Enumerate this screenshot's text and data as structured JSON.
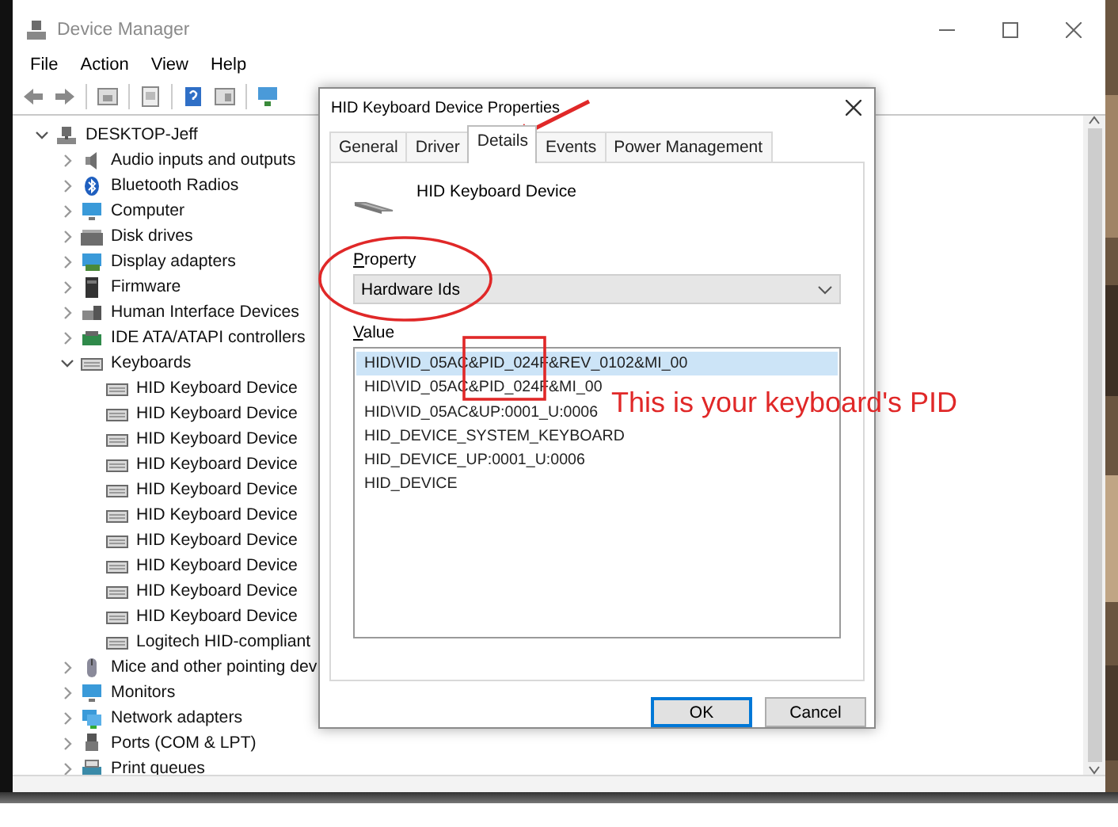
{
  "window": {
    "title": "Device Manager",
    "menu": [
      "File",
      "Action",
      "View",
      "Help"
    ]
  },
  "tree": {
    "label": "DESKTOP-Jeff",
    "kind": "computer",
    "expanded": true,
    "children": [
      {
        "label": "Audio inputs and outputs",
        "kind": "speaker",
        "expanded": false
      },
      {
        "label": "Bluetooth Radios",
        "kind": "bluetooth",
        "expanded": false
      },
      {
        "label": "Computer",
        "kind": "monitor",
        "expanded": false
      },
      {
        "label": "Disk drives",
        "kind": "drive",
        "expanded": false
      },
      {
        "label": "Display adapters",
        "kind": "display",
        "expanded": false
      },
      {
        "label": "Firmware",
        "kind": "chip",
        "expanded": false
      },
      {
        "label": "Human Interface Devices",
        "kind": "hid",
        "expanded": false
      },
      {
        "label": "IDE ATA/ATAPI controllers",
        "kind": "controller",
        "expanded": false
      },
      {
        "label": "Keyboards",
        "kind": "keyboard",
        "expanded": true,
        "children": [
          {
            "label": "HID Keyboard Device",
            "kind": "keyboard"
          },
          {
            "label": "HID Keyboard Device",
            "kind": "keyboard"
          },
          {
            "label": "HID Keyboard Device",
            "kind": "keyboard"
          },
          {
            "label": "HID Keyboard Device",
            "kind": "keyboard"
          },
          {
            "label": "HID Keyboard Device",
            "kind": "keyboard"
          },
          {
            "label": "HID Keyboard Device",
            "kind": "keyboard"
          },
          {
            "label": "HID Keyboard Device",
            "kind": "keyboard"
          },
          {
            "label": "HID Keyboard Device",
            "kind": "keyboard"
          },
          {
            "label": "HID Keyboard Device",
            "kind": "keyboard"
          },
          {
            "label": "HID Keyboard Device",
            "kind": "keyboard"
          },
          {
            "label": "Logitech HID-compliant",
            "kind": "keyboard"
          }
        ]
      },
      {
        "label": "Mice and other pointing dev",
        "kind": "mouse",
        "expanded": false
      },
      {
        "label": "Monitors",
        "kind": "monitor",
        "expanded": false
      },
      {
        "label": "Network adapters",
        "kind": "network",
        "expanded": false
      },
      {
        "label": "Ports (COM & LPT)",
        "kind": "port",
        "expanded": false
      },
      {
        "label": "Print queues",
        "kind": "printer",
        "expanded": false
      }
    ]
  },
  "dialog": {
    "title": "HID Keyboard Device Properties",
    "tabs": [
      {
        "label": "General",
        "selected": false
      },
      {
        "label": "Driver",
        "selected": false
      },
      {
        "label": "Details",
        "selected": true
      },
      {
        "label": "Events",
        "selected": false
      },
      {
        "label": "Power Management",
        "selected": false
      }
    ],
    "device_name": "HID Keyboard Device",
    "property_label": "Property",
    "property_value": "Hardware Ids",
    "value_label": "Value",
    "values": [
      {
        "text": "HID\\VID_05AC&PID_024F&REV_0102&MI_00",
        "selected": true
      },
      {
        "text": "HID\\VID_05AC&PID_024F&MI_00",
        "selected": false
      },
      {
        "text": "HID\\VID_05AC&UP:0001_U:0006",
        "selected": false
      },
      {
        "text": "HID_DEVICE_SYSTEM_KEYBOARD",
        "selected": false
      },
      {
        "text": "HID_DEVICE_UP:0001_U:0006",
        "selected": false
      },
      {
        "text": "HID_DEVICE",
        "selected": false
      }
    ],
    "buttons": [
      {
        "label": "OK",
        "default": true
      },
      {
        "label": "Cancel",
        "default": false
      }
    ]
  },
  "annotation": {
    "text": "This is your keyboard's PID"
  }
}
